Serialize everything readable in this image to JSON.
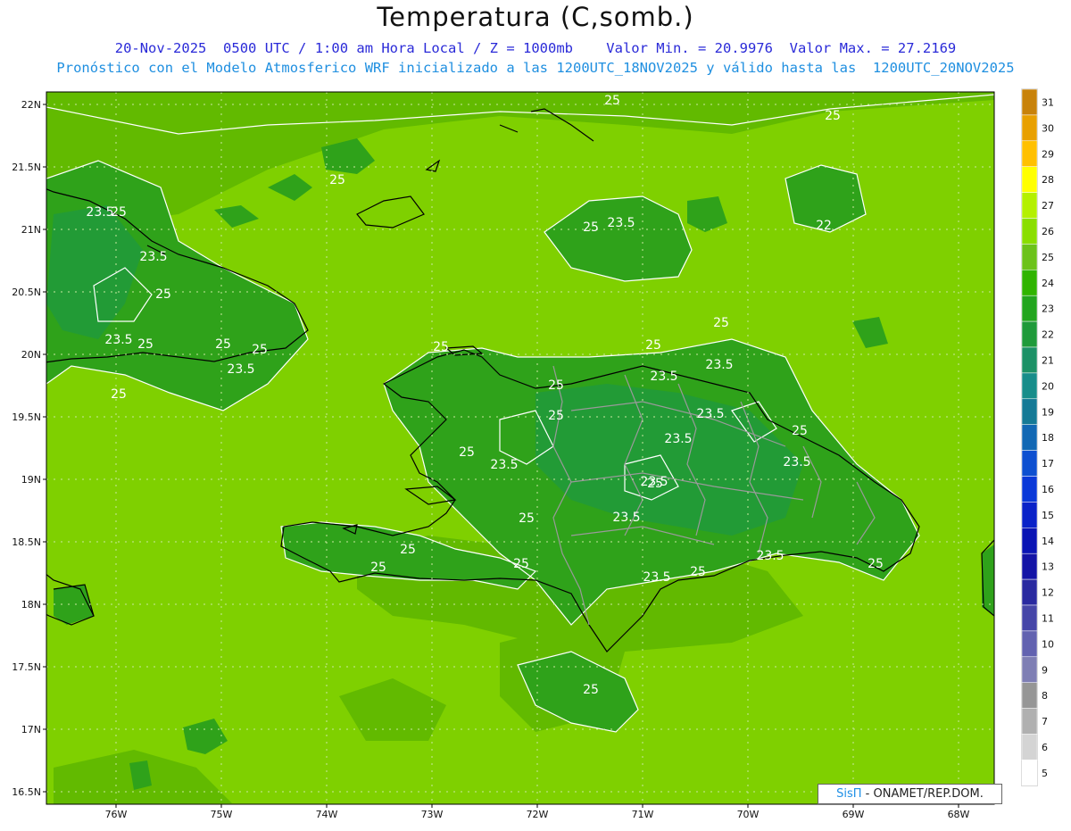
{
  "header": {
    "title": "Temperatura (C,somb.)",
    "subtitle_line1": "20-Nov-2025  0500 UTC / 1:00 am Hora Local / Z = 1000mb    Valor Min. = 20.9976  Valor Max. = 27.2169",
    "subtitle_line2": "Pronóstico con el Modelo Atmosferico WRF inicializado a las 1200UTC_18NOV2025 y válido hasta las  1200UTC_20NOV2025"
  },
  "map": {
    "lat_labels": [
      "22N",
      "21.5N",
      "21N",
      "20.5N",
      "20N",
      "19.5N",
      "19N",
      "18.5N",
      "18N",
      "17.5N",
      "17N",
      "16.5N"
    ],
    "lon_labels": [
      "76W",
      "75W",
      "74W",
      "73W",
      "72W",
      "71W",
      "70W",
      "69W",
      "68W"
    ],
    "contour_labels": [
      "25",
      "25",
      "25",
      "23.5",
      "25",
      "23.5",
      "22",
      "23.5",
      "25",
      "23.5",
      "25",
      "25",
      "23.5",
      "25",
      "25",
      "25",
      "23.5",
      "25",
      "23.5",
      "23.5",
      "25",
      "23.5",
      "25",
      "23.5",
      "23.5",
      "25",
      "25",
      "23.5",
      "25",
      "25",
      "25",
      "23.5",
      "25",
      "25",
      "25",
      "25",
      "25",
      "25",
      "25",
      "23.5",
      "23.5"
    ],
    "colors": {
      "level_25": "#7fd000",
      "level_24": "#5fb700",
      "level_23": "#2fa21a",
      "level_22": "#1f9a3a",
      "coast": "#000000",
      "border": "#999999"
    }
  },
  "colorbar": {
    "labels": [
      "31",
      "30",
      "29",
      "28",
      "27",
      "26",
      "25",
      "24",
      "23",
      "22",
      "21",
      "20",
      "19",
      "18",
      "17",
      "16",
      "15",
      "14",
      "13",
      "12",
      "11",
      "10",
      "9",
      "8",
      "7",
      "6",
      "5"
    ],
    "colors": [
      "#c8820a",
      "#e8a000",
      "#ffc000",
      "#ffff00",
      "#b4f000",
      "#8ade00",
      "#6cc21a",
      "#2fb400",
      "#22a51e",
      "#1f9a3a",
      "#1c9166",
      "#178d8a",
      "#157a96",
      "#1268b4",
      "#0d4fd0",
      "#0a38d8",
      "#0a22c8",
      "#0a14b4",
      "#1414a6",
      "#2a2aa0",
      "#4646a8",
      "#6262b0",
      "#7e7eb4",
      "#969696",
      "#b0b0b0",
      "#d4d4d4",
      "#ffffff"
    ]
  },
  "credit": {
    "sis": "SisΠ",
    "text": " - ONAMET/REP.DOM."
  }
}
